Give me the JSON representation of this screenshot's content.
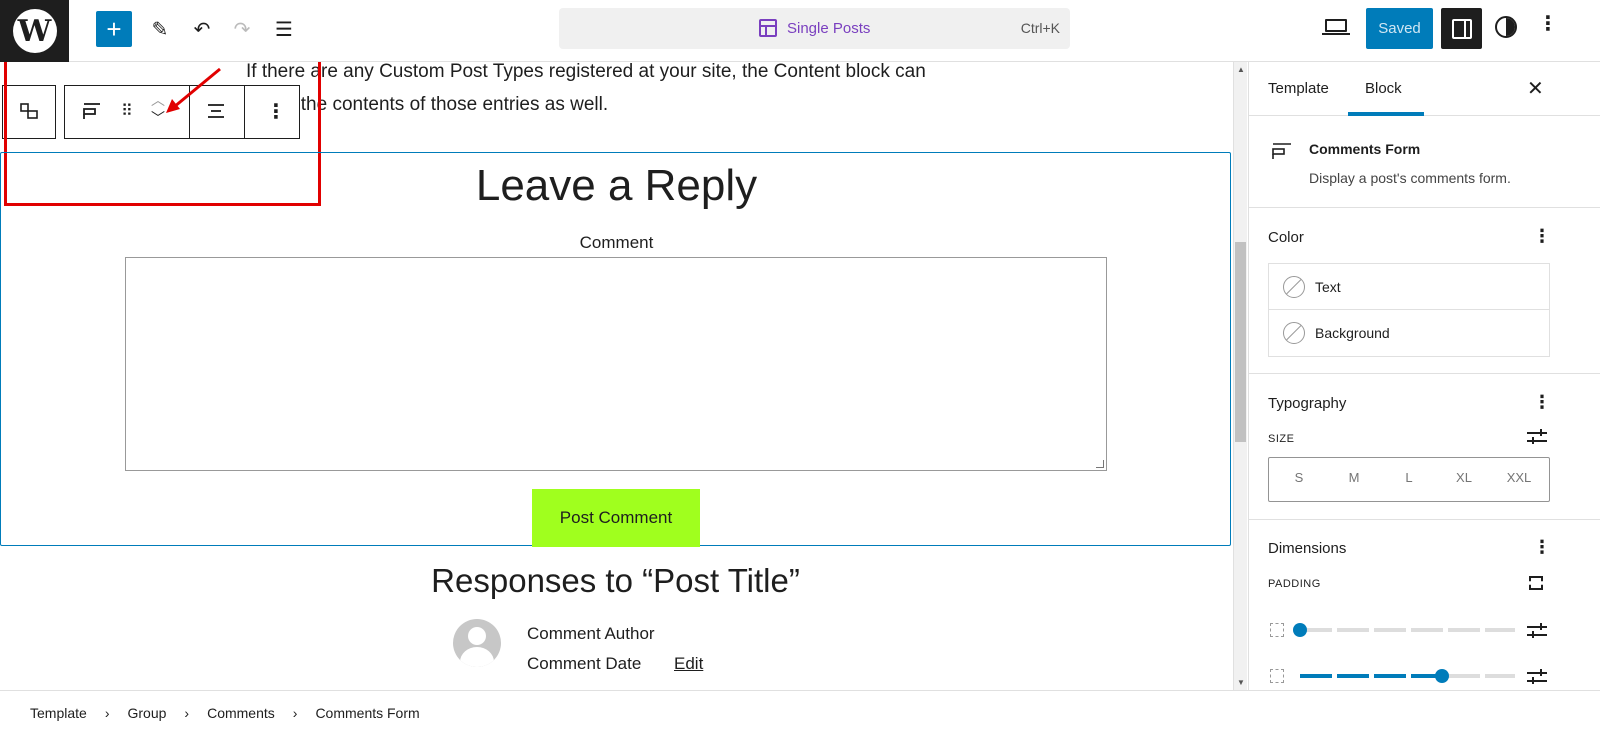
{
  "header": {
    "command_title": "Single Posts",
    "command_shortcut": "Ctrl+K",
    "saved_label": "Saved"
  },
  "canvas": {
    "intro_line1": "If there are any Custom Post Types registered at your site, the Content block can",
    "intro_line2": "y the contents of those entries as well.",
    "reply_title": "Leave a Reply",
    "comment_label": "Comment",
    "post_button": "Post Comment",
    "responses_title": "Responses to “Post Title”",
    "comment_author": "Comment Author",
    "comment_date": "Comment Date",
    "edit_link": "Edit"
  },
  "annotation": {
    "color": "#e10000"
  },
  "sidebar": {
    "tabs": [
      "Template",
      "Block"
    ],
    "active_tab": "Block",
    "block_card": {
      "title": "Comments Form",
      "description": "Display a post's comments form."
    },
    "color_panel": {
      "title": "Color",
      "items": [
        "Text",
        "Background"
      ]
    },
    "typography_panel": {
      "title": "Typography",
      "size_label": "SIZE",
      "sizes": [
        "S",
        "M",
        "L",
        "XL",
        "XXL"
      ]
    },
    "dimensions_panel": {
      "title": "Dimensions",
      "padding_label": "PADDING",
      "padding_vertical_value": 0,
      "padding_horizontal_value": 0.8
    }
  },
  "breadcrumb": [
    "Template",
    "Group",
    "Comments",
    "Comments Form"
  ],
  "colors": {
    "accent": "#007cba",
    "post_button": "#a0ff1e",
    "template_purple": "#7a3fbf"
  }
}
